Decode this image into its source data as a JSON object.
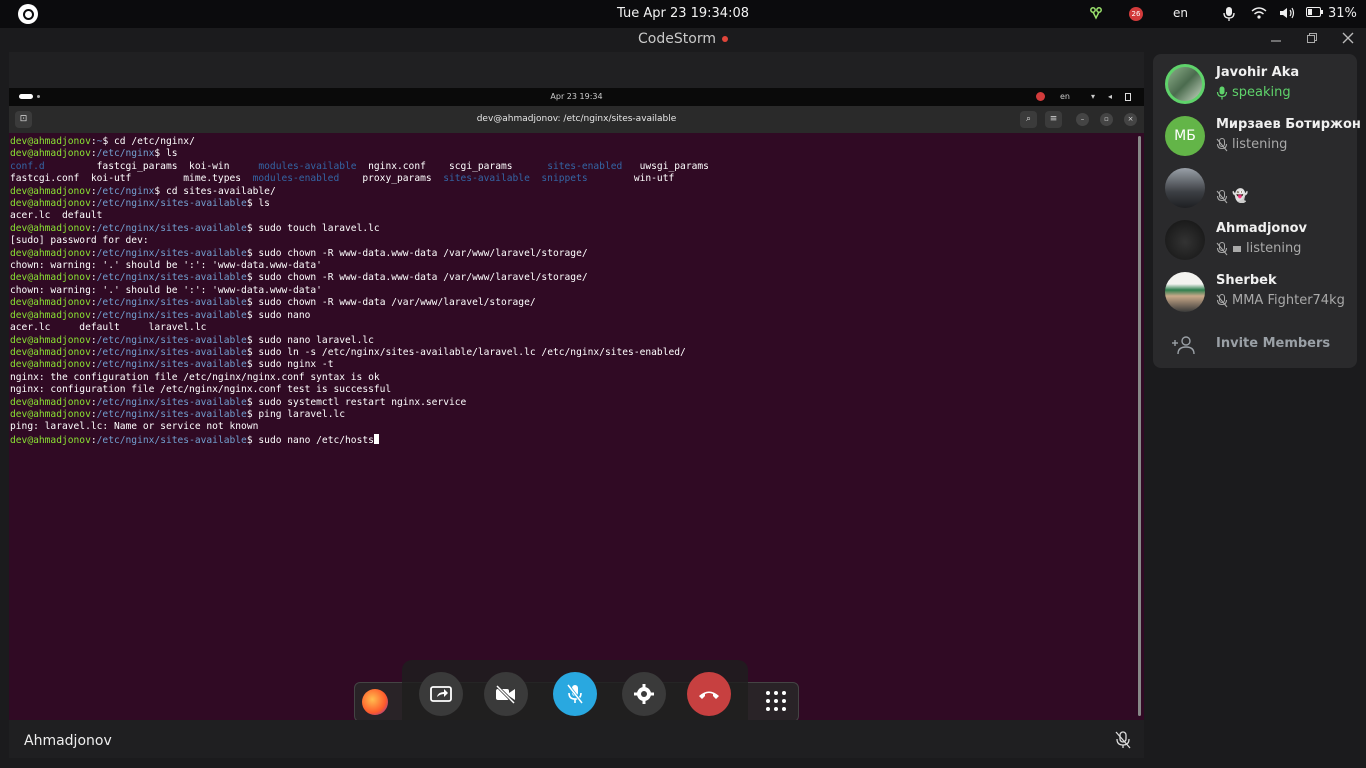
{
  "system_bar": {
    "clock": "Tue Apr 23  19:34:08",
    "notification_count": "26",
    "language": "en",
    "battery": "31%"
  },
  "app": {
    "title": "CodeStorm"
  },
  "shared_screen": {
    "inner_clock": "Apr 23  19:34",
    "inner_language": "en",
    "terminal_title": "dev@ahmadjonov: /etc/nginx/sites-available",
    "terminal_lines": [
      [
        {
          "c": "usr",
          "t": "dev@ahmadjonov"
        },
        {
          "c": "",
          "t": ":"
        },
        {
          "c": "pth",
          "t": "~"
        },
        {
          "c": "",
          "t": "$ cd /etc/nginx/"
        }
      ],
      [
        {
          "c": "usr",
          "t": "dev@ahmadjonov"
        },
        {
          "c": "",
          "t": ":"
        },
        {
          "c": "pth",
          "t": "/etc/nginx"
        },
        {
          "c": "",
          "t": "$ ls"
        }
      ],
      [
        {
          "c": "dir",
          "t": "conf.d"
        },
        {
          "c": "",
          "t": "         fastcgi_params  koi-win     "
        },
        {
          "c": "dir",
          "t": "modules-available"
        },
        {
          "c": "",
          "t": "  nginx.conf    scgi_params      "
        },
        {
          "c": "dir",
          "t": "sites-enabled"
        },
        {
          "c": "",
          "t": "   uwsgi_params"
        }
      ],
      [
        {
          "c": "",
          "t": "fastcgi.conf  koi-utf         mime.types  "
        },
        {
          "c": "dir",
          "t": "modules-enabled"
        },
        {
          "c": "",
          "t": "    proxy_params  "
        },
        {
          "c": "dir",
          "t": "sites-available"
        },
        {
          "c": "",
          "t": "  "
        },
        {
          "c": "dir",
          "t": "snippets"
        },
        {
          "c": "",
          "t": "        win-utf"
        }
      ],
      [
        {
          "c": "usr",
          "t": "dev@ahmadjonov"
        },
        {
          "c": "",
          "t": ":"
        },
        {
          "c": "pth",
          "t": "/etc/nginx"
        },
        {
          "c": "",
          "t": "$ cd sites-available/"
        }
      ],
      [
        {
          "c": "usr",
          "t": "dev@ahmadjonov"
        },
        {
          "c": "",
          "t": ":"
        },
        {
          "c": "pth",
          "t": "/etc/nginx/sites-available"
        },
        {
          "c": "",
          "t": "$ ls"
        }
      ],
      [
        {
          "c": "",
          "t": "acer.lc  default"
        }
      ],
      [
        {
          "c": "usr",
          "t": "dev@ahmadjonov"
        },
        {
          "c": "",
          "t": ":"
        },
        {
          "c": "pth",
          "t": "/etc/nginx/sites-available"
        },
        {
          "c": "",
          "t": "$ sudo touch laravel.lc"
        }
      ],
      [
        {
          "c": "",
          "t": "[sudo] password for dev:"
        }
      ],
      [
        {
          "c": "usr",
          "t": "dev@ahmadjonov"
        },
        {
          "c": "",
          "t": ":"
        },
        {
          "c": "pth",
          "t": "/etc/nginx/sites-available"
        },
        {
          "c": "",
          "t": "$ sudo chown -R www-data.www-data /var/www/laravel/storage/"
        }
      ],
      [
        {
          "c": "",
          "t": "chown: warning: '.' should be ':': 'www-data.www-data'"
        }
      ],
      [
        {
          "c": "usr",
          "t": "dev@ahmadjonov"
        },
        {
          "c": "",
          "t": ":"
        },
        {
          "c": "pth",
          "t": "/etc/nginx/sites-available"
        },
        {
          "c": "",
          "t": "$ sudo chown -R www-data.www-data /var/www/laravel/storage/"
        }
      ],
      [
        {
          "c": "",
          "t": "chown: warning: '.' should be ':': 'www-data.www-data'"
        }
      ],
      [
        {
          "c": "usr",
          "t": "dev@ahmadjonov"
        },
        {
          "c": "",
          "t": ":"
        },
        {
          "c": "pth",
          "t": "/etc/nginx/sites-available"
        },
        {
          "c": "",
          "t": "$ sudo chown -R www-data /var/www/laravel/storage/"
        }
      ],
      [
        {
          "c": "usr",
          "t": "dev@ahmadjonov"
        },
        {
          "c": "",
          "t": ":"
        },
        {
          "c": "pth",
          "t": "/etc/nginx/sites-available"
        },
        {
          "c": "",
          "t": "$ sudo nano"
        }
      ],
      [
        {
          "c": "",
          "t": "acer.lc     default     laravel.lc"
        }
      ],
      [
        {
          "c": "usr",
          "t": "dev@ahmadjonov"
        },
        {
          "c": "",
          "t": ":"
        },
        {
          "c": "pth",
          "t": "/etc/nginx/sites-available"
        },
        {
          "c": "",
          "t": "$ sudo nano laravel.lc"
        }
      ],
      [
        {
          "c": "usr",
          "t": "dev@ahmadjonov"
        },
        {
          "c": "",
          "t": ":"
        },
        {
          "c": "pth",
          "t": "/etc/nginx/sites-available"
        },
        {
          "c": "",
          "t": "$ sudo ln -s /etc/nginx/sites-available/laravel.lc /etc/nginx/sites-enabled/"
        }
      ],
      [
        {
          "c": "usr",
          "t": "dev@ahmadjonov"
        },
        {
          "c": "",
          "t": ":"
        },
        {
          "c": "pth",
          "t": "/etc/nginx/sites-available"
        },
        {
          "c": "",
          "t": "$ sudo nginx -t"
        }
      ],
      [
        {
          "c": "",
          "t": "nginx: the configuration file /etc/nginx/nginx.conf syntax is ok"
        }
      ],
      [
        {
          "c": "",
          "t": "nginx: configuration file /etc/nginx/nginx.conf test is successful"
        }
      ],
      [
        {
          "c": "usr",
          "t": "dev@ahmadjonov"
        },
        {
          "c": "",
          "t": ":"
        },
        {
          "c": "pth",
          "t": "/etc/nginx/sites-available"
        },
        {
          "c": "",
          "t": "$ sudo systemctl restart nginx.service"
        }
      ],
      [
        {
          "c": "usr",
          "t": "dev@ahmadjonov"
        },
        {
          "c": "",
          "t": ":"
        },
        {
          "c": "pth",
          "t": "/etc/nginx/sites-available"
        },
        {
          "c": "",
          "t": "$ ping laravel.lc"
        }
      ],
      [
        {
          "c": "",
          "t": "ping: laravel.lc: Name or service not known"
        }
      ],
      [
        {
          "c": "usr",
          "t": "dev@ahmadjonov"
        },
        {
          "c": "",
          "t": ":"
        },
        {
          "c": "pth",
          "t": "/etc/nginx/sites-available"
        },
        {
          "c": "",
          "t": "$ sudo nano /etc/hosts"
        }
      ]
    ]
  },
  "call_controls": {
    "buttons": [
      "share-screen",
      "camera-off",
      "mic-muted",
      "settings",
      "end-call"
    ],
    "colors": {
      "mic": "#29a8e0",
      "end_call": "#c74040",
      "default": "#3a3a3a"
    }
  },
  "bottom_bar": {
    "speaker_name": "Ahmadjonov"
  },
  "participants": {
    "items": [
      {
        "name": "Javohir Aka",
        "status": "speaking",
        "avatar_initials": "",
        "avatar_color": "#6c8a5a"
      },
      {
        "name": "Мирзаев Ботиржон",
        "status": "listening",
        "avatar_initials": "МБ",
        "avatar_color": "#63b548"
      },
      {
        "name": "",
        "status": "👻",
        "avatar_initials": "",
        "avatar_color": "#6d6f74"
      },
      {
        "name": "Ahmadjonov",
        "status": "listening",
        "avatar_initials": "",
        "avatar_color": "#1d1d1d"
      },
      {
        "name": "Sherbek",
        "status": "MMA Fighter74kg",
        "avatar_initials": "",
        "avatar_color": "#c9c2b0"
      }
    ],
    "invite_label": "Invite Members"
  }
}
